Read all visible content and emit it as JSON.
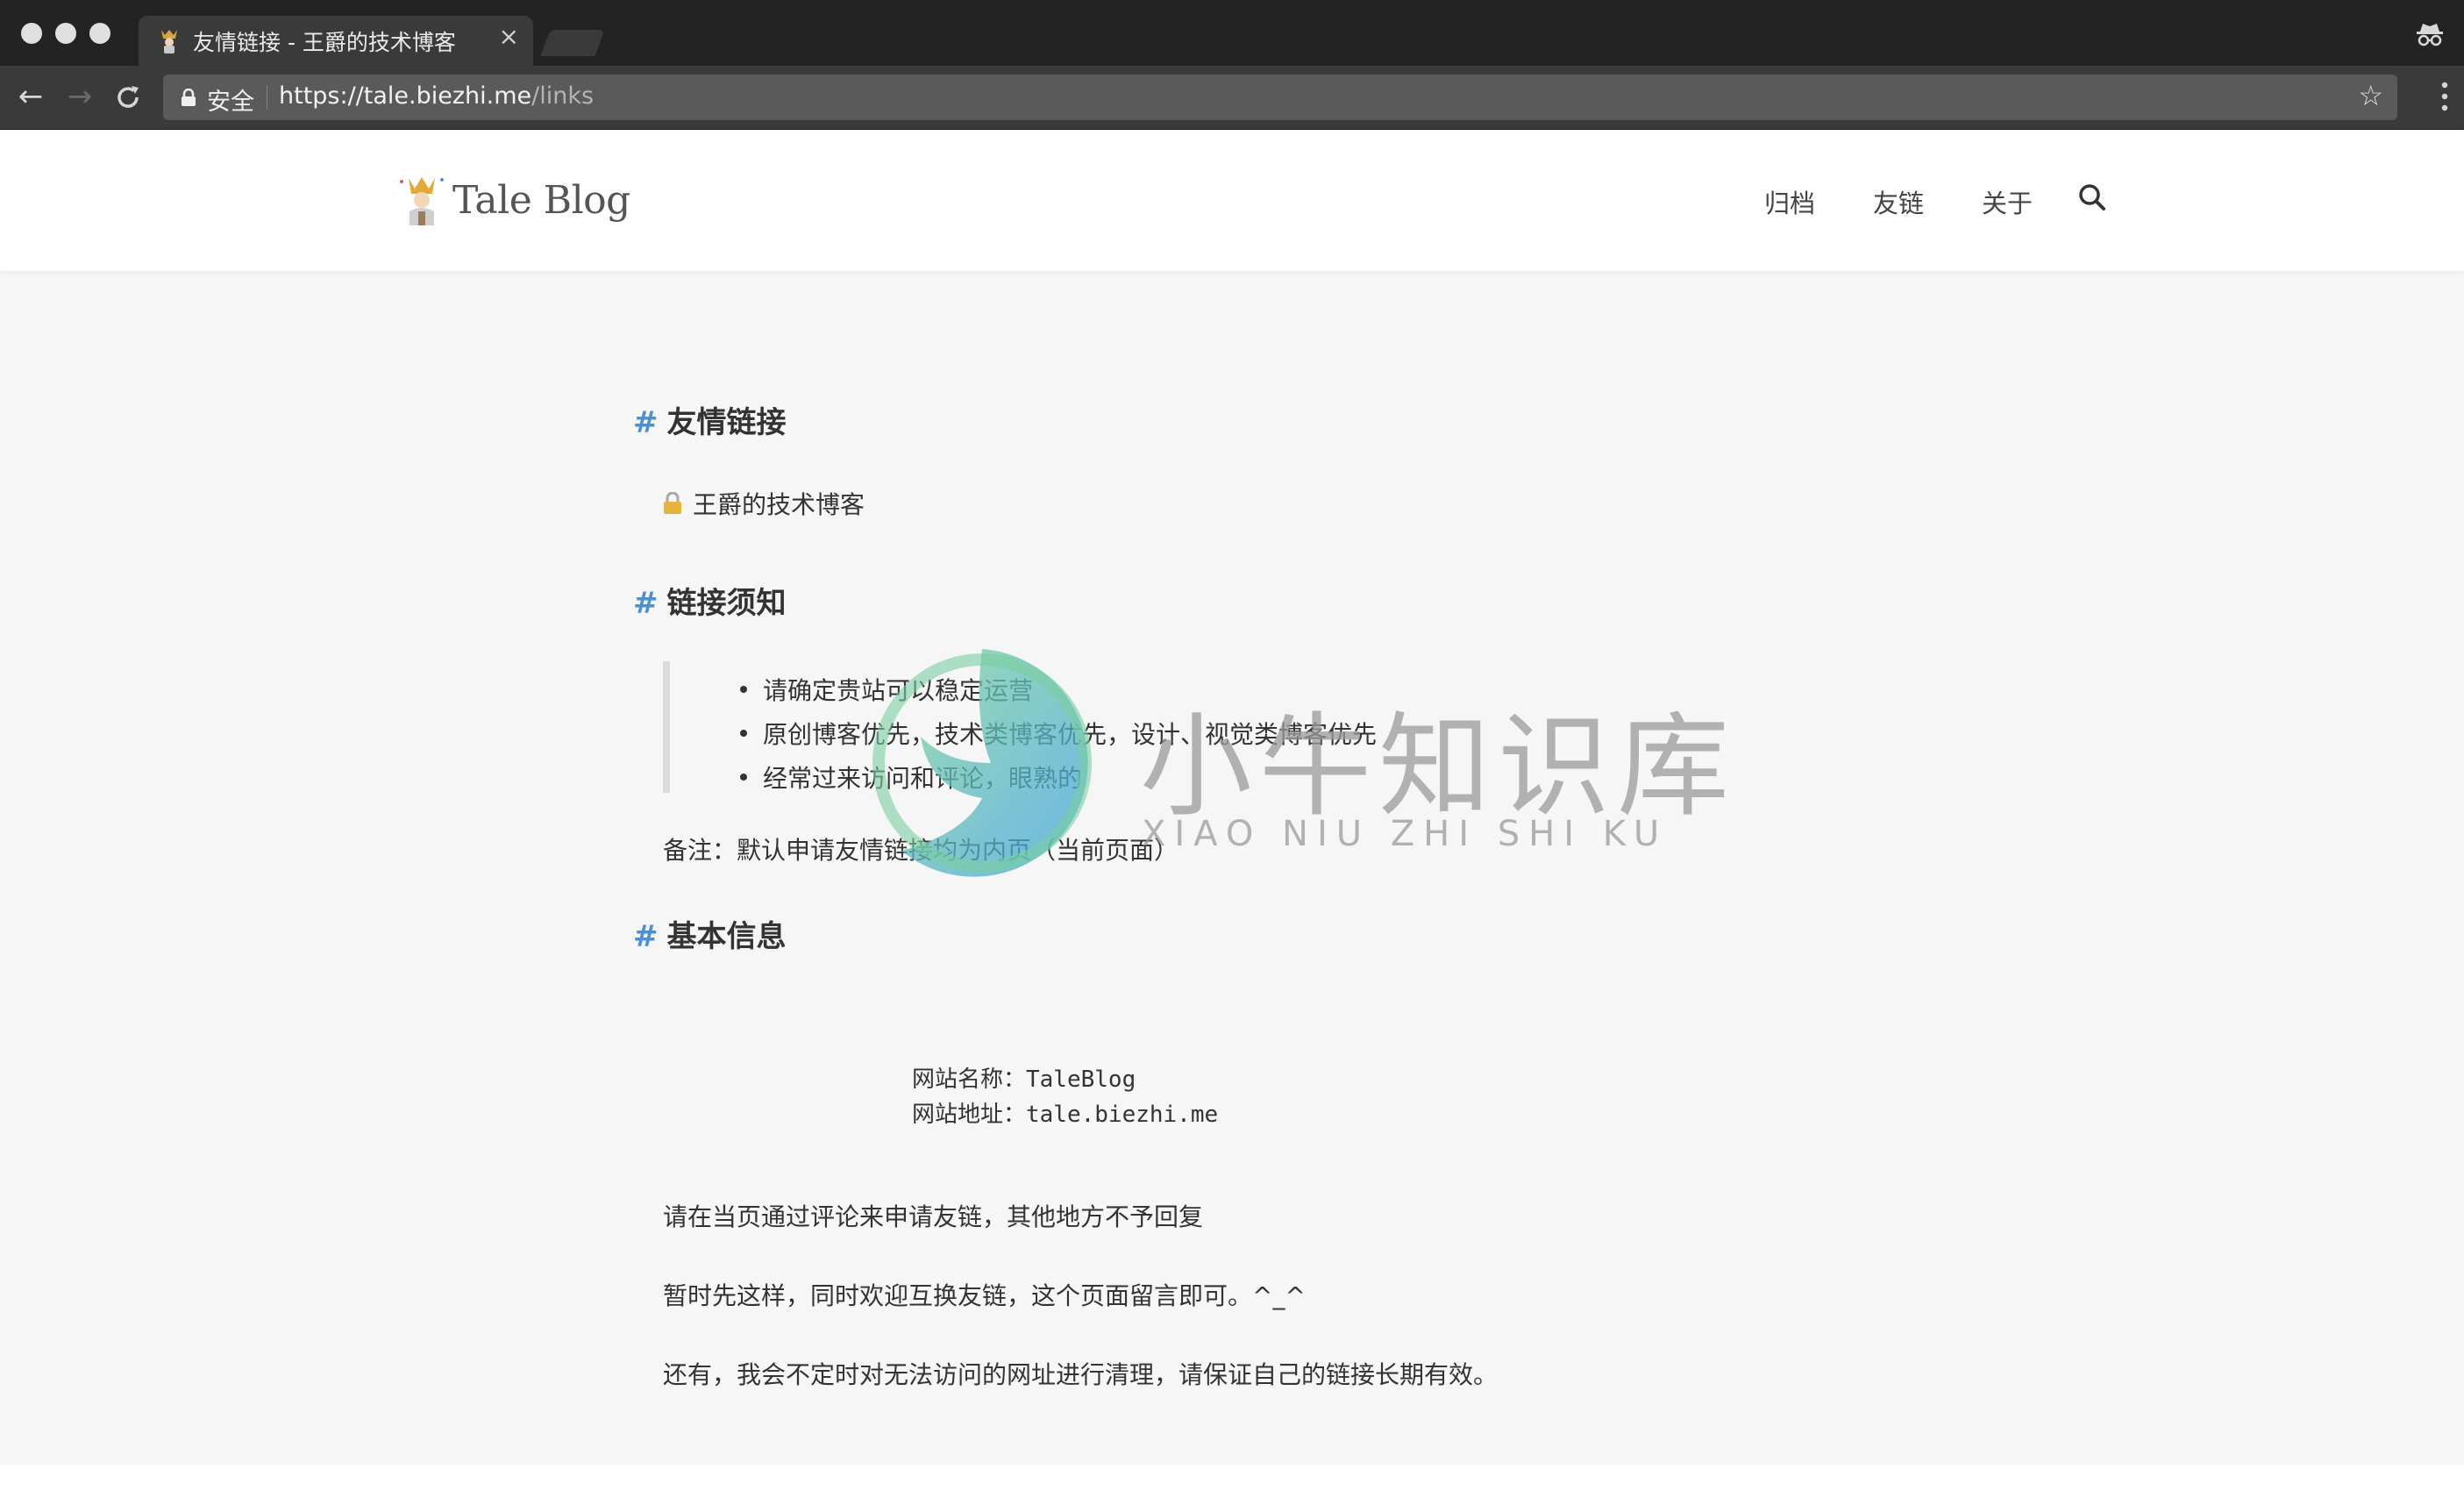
{
  "browser": {
    "tab_title": "友情链接 - 王爵的技术博客",
    "tab_close": "×",
    "secure_label": "安全",
    "url_host": "https://tale.biezhi.me",
    "url_path": "/links"
  },
  "site": {
    "logo_text": "Tale Blog",
    "nav": [
      "归档",
      "友链",
      "关于"
    ]
  },
  "content": {
    "section1_title": "友情链接",
    "friend_link": "王爵的技术博客",
    "section2_title": "链接须知",
    "rules": [
      "请确定贵站可以稳定运营",
      "原创博客优先，技术类博客优先，设计、视觉类博客优先",
      "经常过来访问和评论，眼熟的"
    ],
    "note": "备注：默认申请友情链接均为内页（当前页面）",
    "section3_title": "基本信息",
    "site_name_line": "网站名称：TaleBlog",
    "site_url_line": "网站地址：tale.biezhi.me",
    "para1": "请在当页通过评论来申请友链，其他地方不予回复",
    "para2": "暂时先这样，同时欢迎互换友链，这个页面留言即可。^_^",
    "para3": "还有，我会不定时对无法访问的网址进行清理，请保证自己的链接长期有效。",
    "hash": "#"
  },
  "watermark": {
    "cn": "小牛知识库",
    "en": "XIAO NIU ZHI SHI KU"
  },
  "colors": {
    "accent": "#4a90d9",
    "chrome_dark": "#232323",
    "page_bg": "#f6f6f6"
  },
  "icons": [
    "lock-icon",
    "star-icon",
    "search-icon",
    "back-icon",
    "forward-icon",
    "reload-icon",
    "incognito-icon",
    "menu-icon"
  ]
}
